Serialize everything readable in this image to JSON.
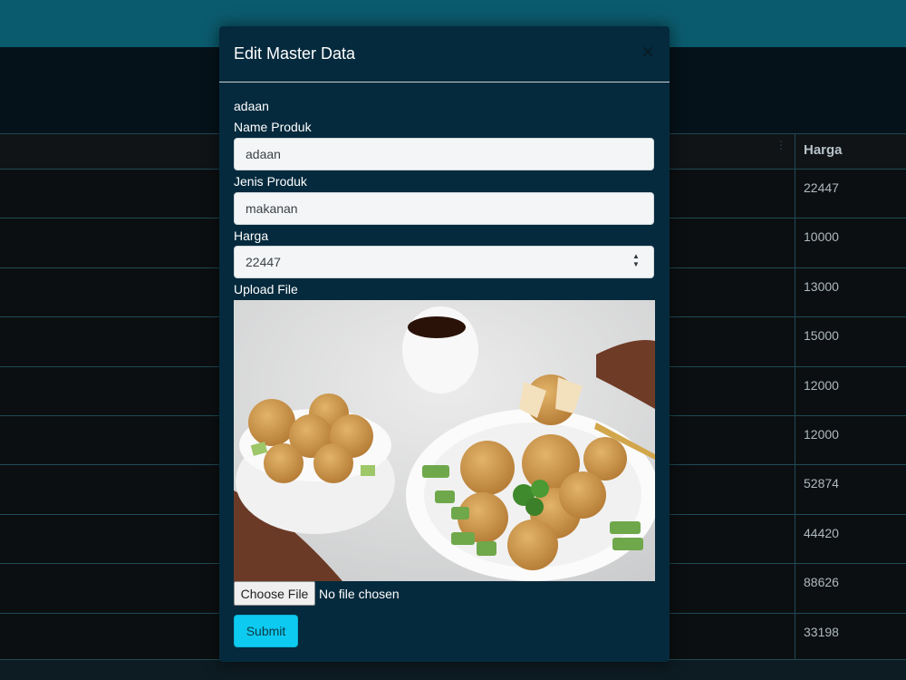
{
  "background_table": {
    "column_header": "Harga",
    "harga_values": [
      "22447",
      "10000",
      "13000",
      "15000",
      "12000",
      "12000",
      "52874",
      "44420",
      "88626",
      "33198"
    ]
  },
  "modal": {
    "title": "Edit Master Data",
    "caption": "adaan",
    "fields": {
      "name_label": "Name Produk",
      "name_value": "adaan",
      "jenis_label": "Jenis Produk",
      "jenis_value": "makanan",
      "harga_label": "Harga",
      "harga_value": "22447",
      "upload_label": "Upload File"
    },
    "file_input": {
      "button_label": "Choose File",
      "status": "No file chosen"
    },
    "submit_label": "Submit"
  },
  "colors": {
    "topbar": "#0b5b6e",
    "modal_bg": "#052a3d",
    "submit": "#0dcaf0"
  },
  "icons": {
    "close": "close-icon",
    "sort": "sort-icon",
    "spinner": "number-spinner-icon"
  }
}
